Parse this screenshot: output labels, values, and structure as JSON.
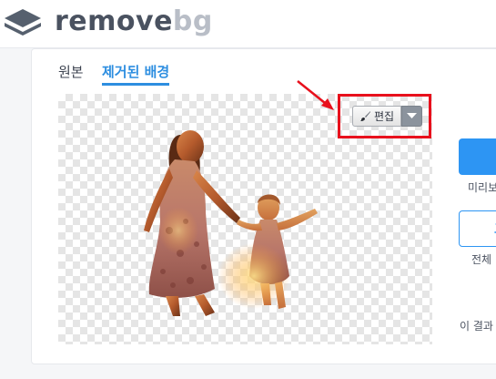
{
  "header": {
    "logo_main": "remove",
    "logo_accent": "bg"
  },
  "tabs": [
    {
      "label": "원본",
      "active": false
    },
    {
      "label": "제거된 배경",
      "active": true
    }
  ],
  "editor": {
    "edit_label": "편집",
    "edit_icon": "brush-icon",
    "dropdown_icon": "caret-down-icon"
  },
  "sidebar": {
    "download_caption": "미리보",
    "hd_button_partial": "고",
    "hd_caption": "전체",
    "rate_text": "이 결과"
  },
  "colors": {
    "accent": "#2d95f3",
    "highlight": "#e8101c",
    "logo": "#4a5260",
    "logo_accent": "#b9bec7"
  }
}
